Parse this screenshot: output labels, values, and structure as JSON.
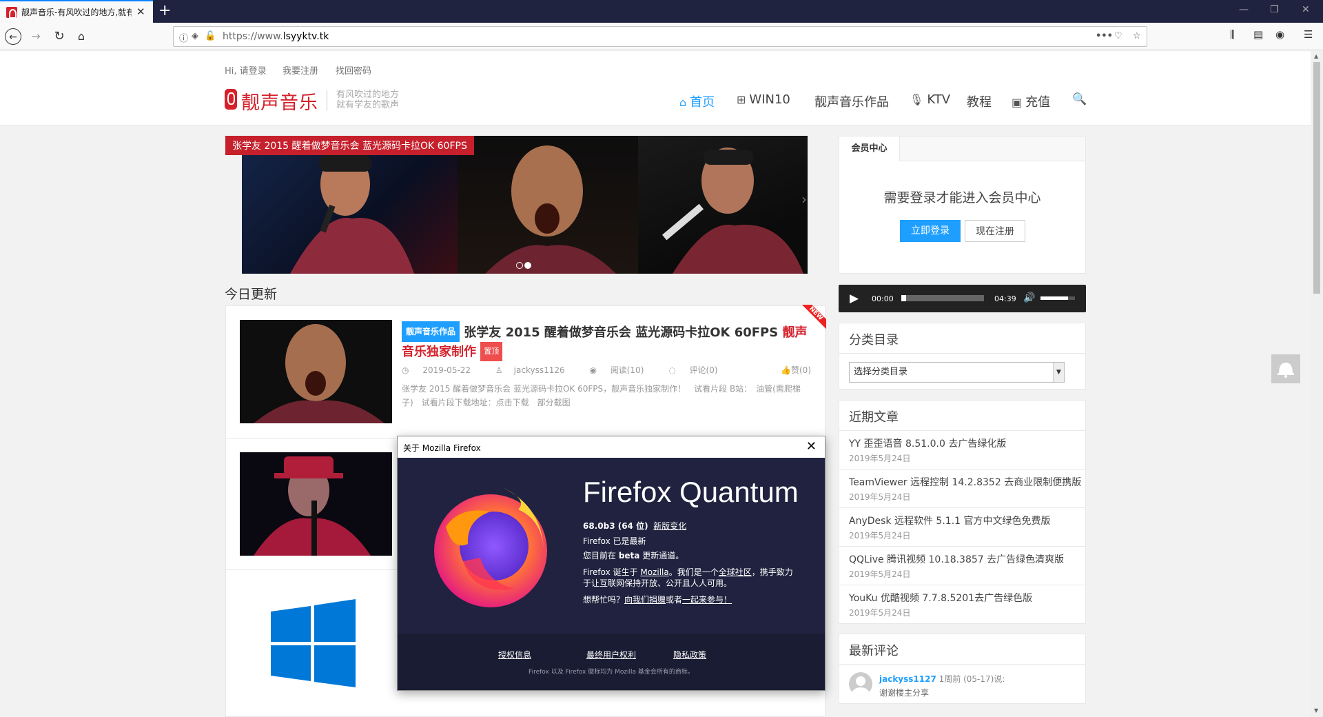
{
  "browser": {
    "tab_title": "靓声音乐-有风吹过的地方,就有",
    "url": "https://www.lsyyktv.tk",
    "url_host": "lsyyktv.tk",
    "url_prefix": "https://www."
  },
  "site": {
    "top_links": [
      "Hi, 请登录",
      "我要注册",
      "找回密码"
    ],
    "logo_name": "靓声音乐",
    "tagline_1": "有风吹过的地方",
    "tagline_2": "就有学友的歌声",
    "nav": [
      {
        "label": "首页",
        "icon": "home-icon",
        "active": true
      },
      {
        "label": "WIN10",
        "icon": "windows-icon"
      },
      {
        "label": "靓声音乐作品",
        "icon": ""
      },
      {
        "label": "KTV",
        "icon": "microphone-icon"
      },
      {
        "label": "教程",
        "icon": ""
      },
      {
        "label": "充值",
        "icon": "wallet-icon"
      }
    ]
  },
  "slider": {
    "caption": "张学友 2015 醒着做梦音乐会 蓝光源码卡拉OK 60FPS"
  },
  "section_title": "今日更新",
  "posts": [
    {
      "category": "靓声音乐作品",
      "title": "张学友 2015 醒着做梦音乐会 蓝光源码卡拉OK 60FPS ",
      "title_red": "靓声音乐独家制作",
      "top_badge": "置顶",
      "date": "2019-05-22",
      "author": "jackyss1126",
      "reads": "阅读(10)",
      "comments": "评论(0)",
      "likes": "赞(0)",
      "excerpt": "张学友 2015 醒着做梦音乐会 蓝光源码卡拉OK 60FPS，靓声音乐独家制作！　试看片段 B站：　油管(需爬梯子)　试看片段下载地址：点击下载　部分截图",
      "ribbon": "NEW"
    }
  ],
  "sidebar": {
    "member_tab": "会员中心",
    "member_msg": "需要登录才能进入会员中心",
    "login_btn": "立即登录",
    "register_btn": "现在注册",
    "audio_time_current": "00:00",
    "audio_time_total": "04:39",
    "audio_progress": 0.06,
    "audio_volume": 0.8,
    "category_title": "分类目录",
    "category_select": "选择分类目录",
    "recent_title": "近期文章",
    "recent": [
      {
        "title": "YY 歪歪语音 8.51.0.0 去广告绿化版",
        "date": "2019年5月24日"
      },
      {
        "title": "TeamViewer 远程控制 14.2.8352 去商业限制便携版",
        "date": "2019年5月24日"
      },
      {
        "title": "AnyDesk 远程软件 5.1.1 官方中文绿色免费版",
        "date": "2019年5月24日"
      },
      {
        "title": "QQLive 腾讯视频 10.18.3857 去广告绿色清爽版",
        "date": "2019年5月24日"
      },
      {
        "title": "YouKu 优酷视频 7.7.8.5201去广告绿色版",
        "date": "2019年5月24日"
      }
    ],
    "comments_title": "最新评论",
    "comment_user": "jackyss1127",
    "comment_meta": "1周前 (05-17)说:",
    "comment_text": "谢谢楼主分享"
  },
  "dialog": {
    "title": "关于 Mozilla Firefox",
    "product_1": "Firefox",
    "product_2": "Quantum",
    "version": "68.0b3 (64 位)",
    "whats_new": "新版变化",
    "status": "Firefox 已是最新",
    "channel_pre": "您目前在 ",
    "channel": "beta",
    "channel_post": " 更新通道。",
    "born_1": "Firefox 诞生于 ",
    "mozilla": "Mozilla",
    "born_2": "。我们是一个",
    "community": "全球社区",
    "born_3": "，携手致力",
    "born_4": "于让互联网保持开放、公开且人人可用。",
    "help_pre": "想帮忙吗？",
    "donate": "向我们捐赠",
    "help_or": "或者",
    "join": "一起来参与！",
    "footer_links": [
      "授权信息",
      "最终用户权利",
      "隐私政策"
    ],
    "trademark": "Firefox 以及 Firefox 徽标均为 Mozilla 基金会所有的商标。"
  }
}
